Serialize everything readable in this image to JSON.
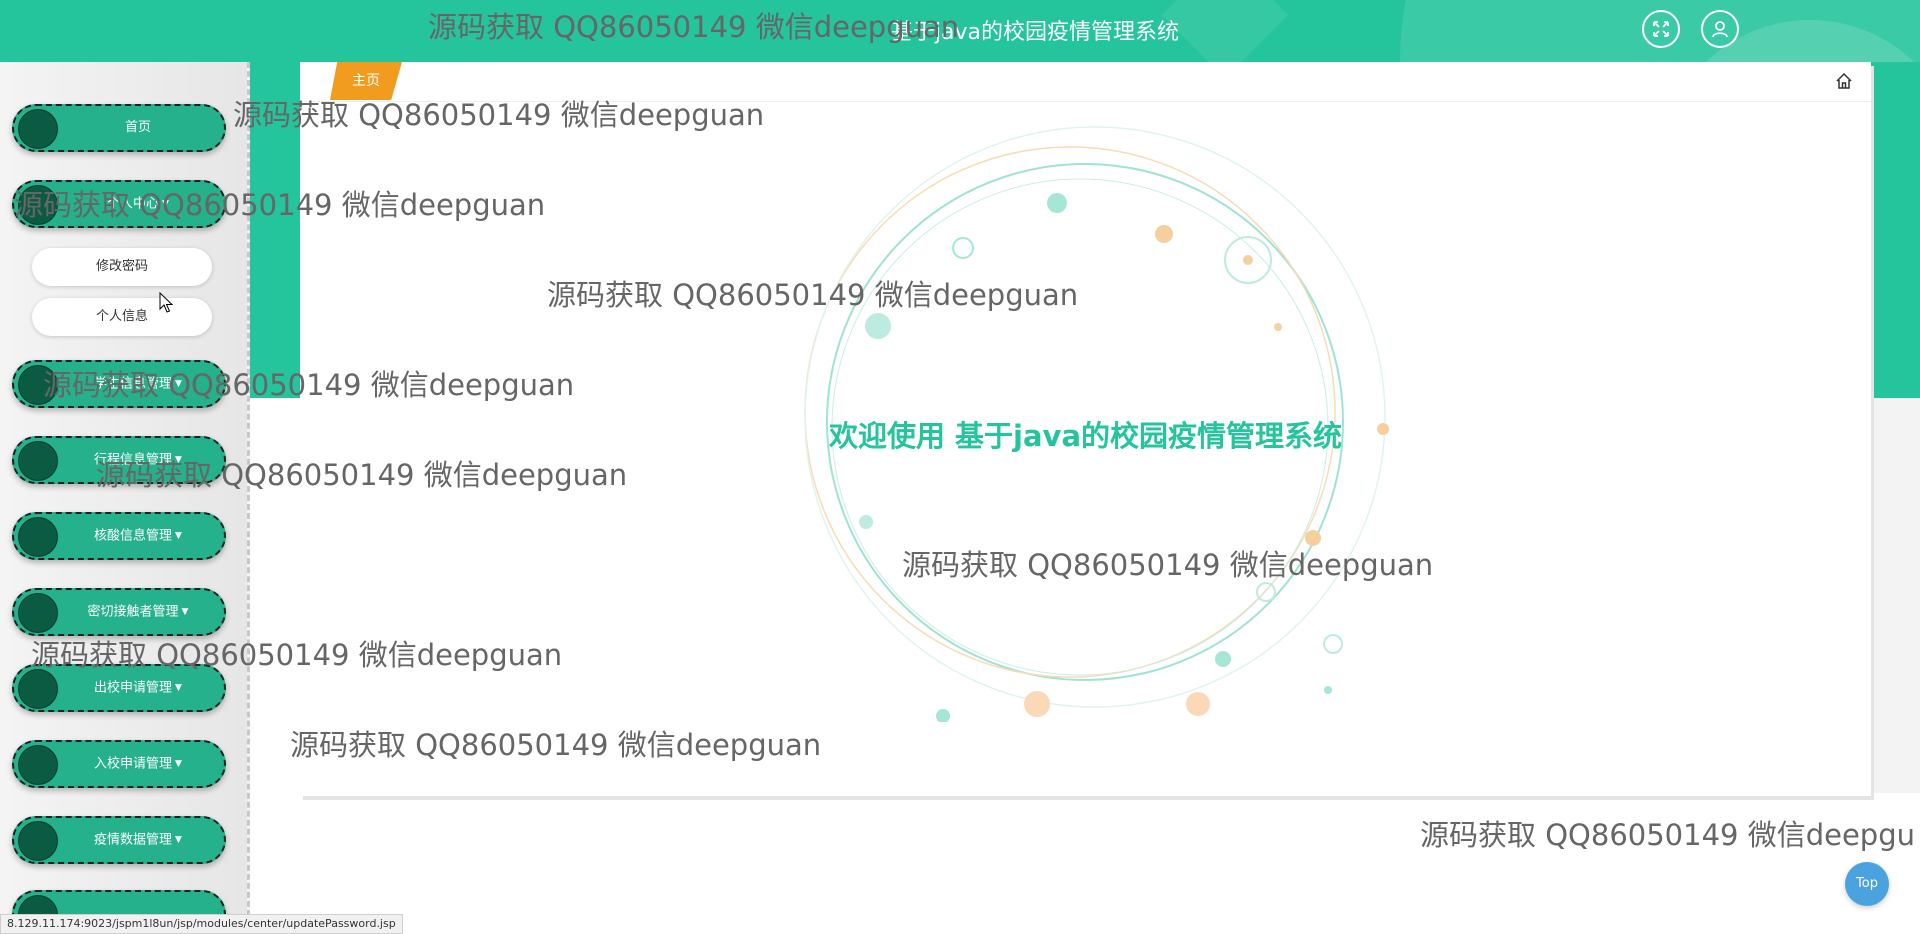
{
  "header": {
    "title": "基于java的校园疫情管理系统"
  },
  "sidebar": {
    "items": [
      {
        "label": "首页",
        "dropdown": false
      },
      {
        "label": "个人中心",
        "dropdown": true
      },
      {
        "label": "学生信息管理",
        "dropdown": true
      },
      {
        "label": "行程信息管理",
        "dropdown": true
      },
      {
        "label": "核酸信息管理",
        "dropdown": true
      },
      {
        "label": "密切接触者管理",
        "dropdown": true
      },
      {
        "label": "出校申请管理",
        "dropdown": true
      },
      {
        "label": "入校申请管理",
        "dropdown": true
      },
      {
        "label": "疫情数据管理",
        "dropdown": true
      }
    ],
    "subitems": [
      {
        "label": "修改密码"
      },
      {
        "label": "个人信息"
      }
    ]
  },
  "tabs": {
    "home": "主页"
  },
  "main": {
    "welcome": "欢迎使用 基于java的校园疫情管理系统"
  },
  "watermark": "源码获取 QQ86050149 微信deepguan",
  "watermark_truncated": "源码获取 QQ86050149 微信deepgu",
  "top_button": "Top",
  "status_url": "8.129.11.174:9023/jspm1l8un/jsp/modules/center/updatePassword.jsp",
  "colors": {
    "primary": "#24c49c",
    "menu": "#24b18b",
    "accent": "#f29c1f",
    "top_button": "#4aa3df"
  }
}
